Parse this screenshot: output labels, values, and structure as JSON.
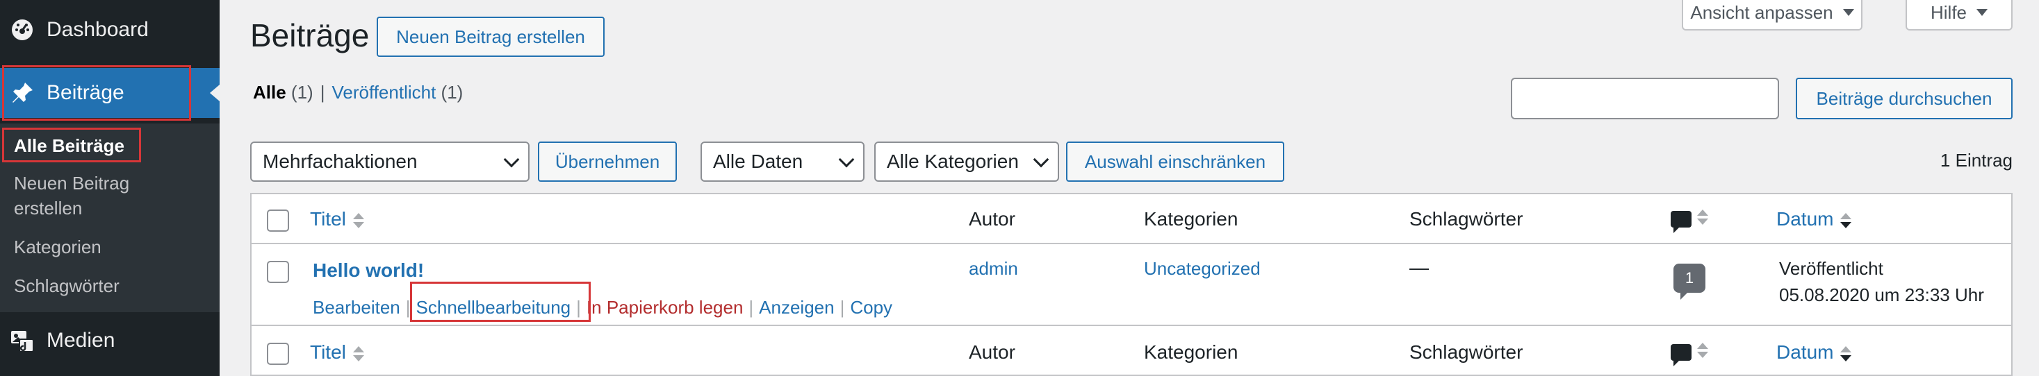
{
  "sidebar": {
    "items": [
      {
        "label": "Dashboard",
        "icon": "dashboard-icon"
      },
      {
        "label": "Beiträge",
        "icon": "pin-icon"
      },
      {
        "label": "Medien",
        "icon": "media-icon"
      }
    ],
    "submenu": [
      "Alle Beiträge",
      "Neuen Beitrag\nerstellen",
      "Kategorien",
      "Schlagwörter"
    ],
    "submenu_lines": [
      "Alle Beiträge",
      "Neuen Beitrag",
      "erstellen",
      "Kategorien",
      "Schlagwörter"
    ]
  },
  "header": {
    "title": "Beiträge",
    "new_button": "Neuen Beitrag erstellen",
    "screen_options": "Ansicht anpassen",
    "help": "Hilfe"
  },
  "filters": {
    "all": "Alle",
    "all_count": "(1)",
    "separator": "|",
    "published": "Veröffentlicht",
    "published_count": "(1)",
    "search_value": "",
    "search_button": "Beiträge durchsuchen",
    "bulk_actions": "Mehrfachaktionen",
    "apply": "Übernehmen",
    "all_dates": "Alle Daten",
    "all_categories": "Alle Kategorien",
    "filter_button": "Auswahl einschränken",
    "item_count": "1 Eintrag"
  },
  "table": {
    "columns": {
      "title": "Titel",
      "author": "Autor",
      "categories": "Kategorien",
      "tags": "Schlagwörter",
      "date": "Datum"
    },
    "rows": [
      {
        "title": "Hello world!",
        "author": "admin",
        "category": "Uncategorized",
        "tags": "—",
        "comments": "1",
        "status": "Veröffentlicht",
        "date": "05.08.2020 um 23:33 Uhr",
        "actions": [
          "Bearbeiten",
          "Schnellbearbeitung",
          "In Papierkorb legen",
          "Anzeigen",
          "Copy"
        ]
      }
    ]
  },
  "colors": {
    "accent": "#2271b1",
    "sidebar_bg": "#1d2327",
    "highlight_box": "#d63638",
    "trash": "#b32d2e"
  }
}
